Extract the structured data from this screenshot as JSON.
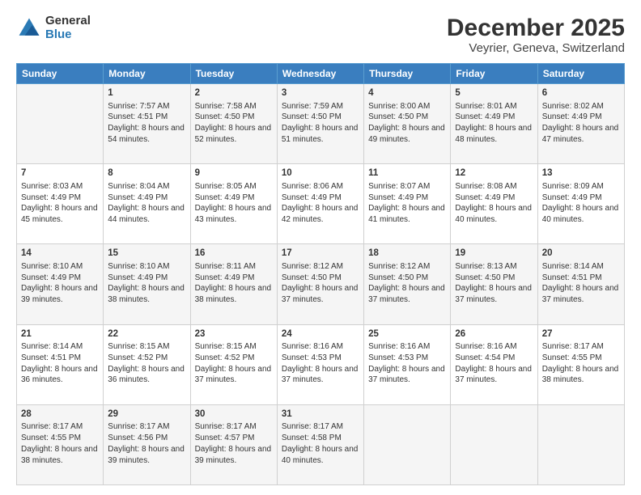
{
  "header": {
    "logo_general": "General",
    "logo_blue": "Blue",
    "title": "December 2025",
    "subtitle": "Veyrier, Geneva, Switzerland"
  },
  "days_of_week": [
    "Sunday",
    "Monday",
    "Tuesday",
    "Wednesday",
    "Thursday",
    "Friday",
    "Saturday"
  ],
  "weeks": [
    [
      {
        "day": "",
        "content": ""
      },
      {
        "day": "1",
        "sunrise": "7:57 AM",
        "sunset": "4:51 PM",
        "daylight": "8 hours and 54 minutes."
      },
      {
        "day": "2",
        "sunrise": "7:58 AM",
        "sunset": "4:50 PM",
        "daylight": "8 hours and 52 minutes."
      },
      {
        "day": "3",
        "sunrise": "7:59 AM",
        "sunset": "4:50 PM",
        "daylight": "8 hours and 51 minutes."
      },
      {
        "day": "4",
        "sunrise": "8:00 AM",
        "sunset": "4:50 PM",
        "daylight": "8 hours and 49 minutes."
      },
      {
        "day": "5",
        "sunrise": "8:01 AM",
        "sunset": "4:49 PM",
        "daylight": "8 hours and 48 minutes."
      },
      {
        "day": "6",
        "sunrise": "8:02 AM",
        "sunset": "4:49 PM",
        "daylight": "8 hours and 47 minutes."
      }
    ],
    [
      {
        "day": "7",
        "sunrise": "8:03 AM",
        "sunset": "4:49 PM",
        "daylight": "8 hours and 45 minutes."
      },
      {
        "day": "8",
        "sunrise": "8:04 AM",
        "sunset": "4:49 PM",
        "daylight": "8 hours and 44 minutes."
      },
      {
        "day": "9",
        "sunrise": "8:05 AM",
        "sunset": "4:49 PM",
        "daylight": "8 hours and 43 minutes."
      },
      {
        "day": "10",
        "sunrise": "8:06 AM",
        "sunset": "4:49 PM",
        "daylight": "8 hours and 42 minutes."
      },
      {
        "day": "11",
        "sunrise": "8:07 AM",
        "sunset": "4:49 PM",
        "daylight": "8 hours and 41 minutes."
      },
      {
        "day": "12",
        "sunrise": "8:08 AM",
        "sunset": "4:49 PM",
        "daylight": "8 hours and 40 minutes."
      },
      {
        "day": "13",
        "sunrise": "8:09 AM",
        "sunset": "4:49 PM",
        "daylight": "8 hours and 40 minutes."
      }
    ],
    [
      {
        "day": "14",
        "sunrise": "8:10 AM",
        "sunset": "4:49 PM",
        "daylight": "8 hours and 39 minutes."
      },
      {
        "day": "15",
        "sunrise": "8:10 AM",
        "sunset": "4:49 PM",
        "daylight": "8 hours and 38 minutes."
      },
      {
        "day": "16",
        "sunrise": "8:11 AM",
        "sunset": "4:49 PM",
        "daylight": "8 hours and 38 minutes."
      },
      {
        "day": "17",
        "sunrise": "8:12 AM",
        "sunset": "4:50 PM",
        "daylight": "8 hours and 37 minutes."
      },
      {
        "day": "18",
        "sunrise": "8:12 AM",
        "sunset": "4:50 PM",
        "daylight": "8 hours and 37 minutes."
      },
      {
        "day": "19",
        "sunrise": "8:13 AM",
        "sunset": "4:50 PM",
        "daylight": "8 hours and 37 minutes."
      },
      {
        "day": "20",
        "sunrise": "8:14 AM",
        "sunset": "4:51 PM",
        "daylight": "8 hours and 37 minutes."
      }
    ],
    [
      {
        "day": "21",
        "sunrise": "8:14 AM",
        "sunset": "4:51 PM",
        "daylight": "8 hours and 36 minutes."
      },
      {
        "day": "22",
        "sunrise": "8:15 AM",
        "sunset": "4:52 PM",
        "daylight": "8 hours and 36 minutes."
      },
      {
        "day": "23",
        "sunrise": "8:15 AM",
        "sunset": "4:52 PM",
        "daylight": "8 hours and 37 minutes."
      },
      {
        "day": "24",
        "sunrise": "8:16 AM",
        "sunset": "4:53 PM",
        "daylight": "8 hours and 37 minutes."
      },
      {
        "day": "25",
        "sunrise": "8:16 AM",
        "sunset": "4:53 PM",
        "daylight": "8 hours and 37 minutes."
      },
      {
        "day": "26",
        "sunrise": "8:16 AM",
        "sunset": "4:54 PM",
        "daylight": "8 hours and 37 minutes."
      },
      {
        "day": "27",
        "sunrise": "8:17 AM",
        "sunset": "4:55 PM",
        "daylight": "8 hours and 38 minutes."
      }
    ],
    [
      {
        "day": "28",
        "sunrise": "8:17 AM",
        "sunset": "4:55 PM",
        "daylight": "8 hours and 38 minutes."
      },
      {
        "day": "29",
        "sunrise": "8:17 AM",
        "sunset": "4:56 PM",
        "daylight": "8 hours and 39 minutes."
      },
      {
        "day": "30",
        "sunrise": "8:17 AM",
        "sunset": "4:57 PM",
        "daylight": "8 hours and 39 minutes."
      },
      {
        "day": "31",
        "sunrise": "8:17 AM",
        "sunset": "4:58 PM",
        "daylight": "8 hours and 40 minutes."
      },
      {
        "day": "",
        "content": ""
      },
      {
        "day": "",
        "content": ""
      },
      {
        "day": "",
        "content": ""
      }
    ]
  ]
}
